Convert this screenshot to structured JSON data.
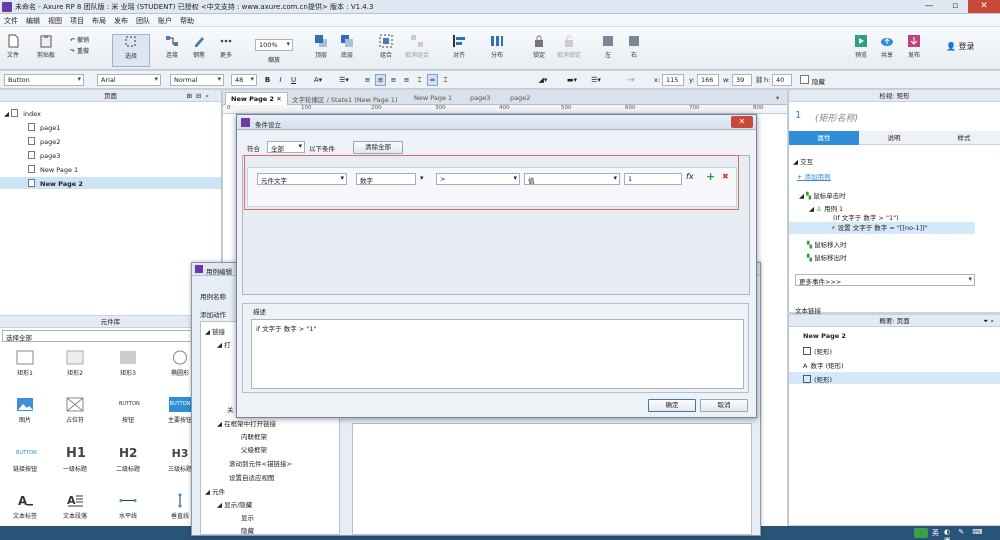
{
  "window": {
    "title": "未命名 - Axure RP 8 团队版 : 米 业瑶 (STUDENT) 已授权     <中文支持 : www.axure.com.cn提供> 版本 : V1.4.3",
    "minimize": "—",
    "maximize": "▫",
    "close": "✕"
  },
  "menu": [
    "文件",
    "编辑",
    "视图",
    "项目",
    "布局",
    "发布",
    "团队",
    "账户",
    "帮助"
  ],
  "ribbon": {
    "file": "文件",
    "clipboard": "剪贴板",
    "undo": "撤销",
    "redo": "重做",
    "select": "选择",
    "connect": "连接",
    "pen": "钢笔",
    "more": "更多",
    "zoom_value": "100%",
    "zoom_label": "缩放",
    "top": "顶层",
    "bottom": "底层",
    "group": "组合",
    "ungroup": "取消组合",
    "align": "对齐",
    "distribute": "分布",
    "lock": "锁定",
    "unlock": "取消锁定",
    "left": "左",
    "right": "右",
    "preview": "预览",
    "share": "共享",
    "publish": "发布",
    "login": "登录"
  },
  "format": {
    "widget_style": "Button",
    "font": "Arial",
    "weight": "Normal",
    "size": "48",
    "bold": "B",
    "italic": "I",
    "underline": "U",
    "x_label": "x:",
    "x": "115",
    "y_label": "y:",
    "y": "166",
    "w_label": "w:",
    "w": "39",
    "h_label": "h:",
    "h": "40",
    "hidden_label": "隐藏"
  },
  "pages_panel": {
    "title": "页面",
    "items": [
      {
        "label": "index"
      },
      {
        "label": "page1"
      },
      {
        "label": "page2"
      },
      {
        "label": "page3"
      },
      {
        "label": "New Page 1"
      },
      {
        "label": "New Page 2"
      }
    ]
  },
  "library_panel": {
    "title": "元件库",
    "filter": "选择全部",
    "widgets": [
      "矩形1",
      "矩形2",
      "矩形3",
      "椭圆形",
      "图片",
      "占位符",
      "按钮",
      "主要按钮",
      "链接按钮",
      "一级标题",
      "二级标题",
      "三级标题",
      "文本标签",
      "文本段落",
      "水平线",
      "垂直线"
    ],
    "button_text": "BUTTON",
    "h1": "H1",
    "h2": "H2",
    "h3": "H3"
  },
  "tabs": [
    {
      "label": "New Page 2"
    },
    {
      "label": "文字轮播区 / State1 (New Page 1)"
    },
    {
      "label": "New Page 1"
    },
    {
      "label": "page3"
    },
    {
      "label": "page2"
    }
  ],
  "ruler": [
    "0",
    "100",
    "200",
    "300",
    "400",
    "500",
    "600",
    "700",
    "800"
  ],
  "inspector": {
    "title": "检视: 矩形",
    "number": "1",
    "shape_name": "(矩形名称)",
    "tabs": [
      "属性",
      "说明",
      "样式"
    ],
    "interaction": "交互",
    "add_case": "添加用例",
    "event_click": "鼠标单击时",
    "case1": "用例 1",
    "case1_cond": "(If 文字于 数字 > \"1\")",
    "case1_action": "设置 文字于 数字 = \"[[no-1]]\"",
    "event_enter": "鼠标移入时",
    "event_leave": "鼠标移出时",
    "more_events": "更多事件>>>",
    "text_link": "文本链接"
  },
  "outline": {
    "title": "概要: 页面",
    "page": "New Page 2",
    "items": [
      {
        "label": "(矩形)"
      },
      {
        "label": "数字 (矩形)"
      },
      {
        "label": "(矩形)"
      }
    ]
  },
  "case_dialog": {
    "title": "用例编辑",
    "case_name_label": "用例名称",
    "add_action_label": "添加动作",
    "tree": [
      "链接",
      "打",
      "关",
      "在框架中打开链接",
      "内联框架",
      "父级框架",
      "滚动到元件<锚链接>",
      "设置自适应视图",
      "元件",
      "显示/隐藏",
      "显示",
      "隐藏"
    ]
  },
  "condition_dialog": {
    "title": "条件设立",
    "match_label": "符合",
    "match_value": "全部",
    "match_suffix": "以下条件",
    "clear_all": "清除全部",
    "row": {
      "target_type": "元件文字",
      "target": "数字",
      "operator": ">",
      "value_type": "值",
      "value": "1",
      "fx": "fx",
      "add": "+",
      "delete": "✖"
    },
    "description_label": "描述",
    "description": "if 文字于 数字 > \"1\"",
    "ok": "确定",
    "cancel": "取消"
  },
  "taskbar": {
    "ime": "英",
    "colors": {
      "bg": "#2a5378"
    }
  }
}
